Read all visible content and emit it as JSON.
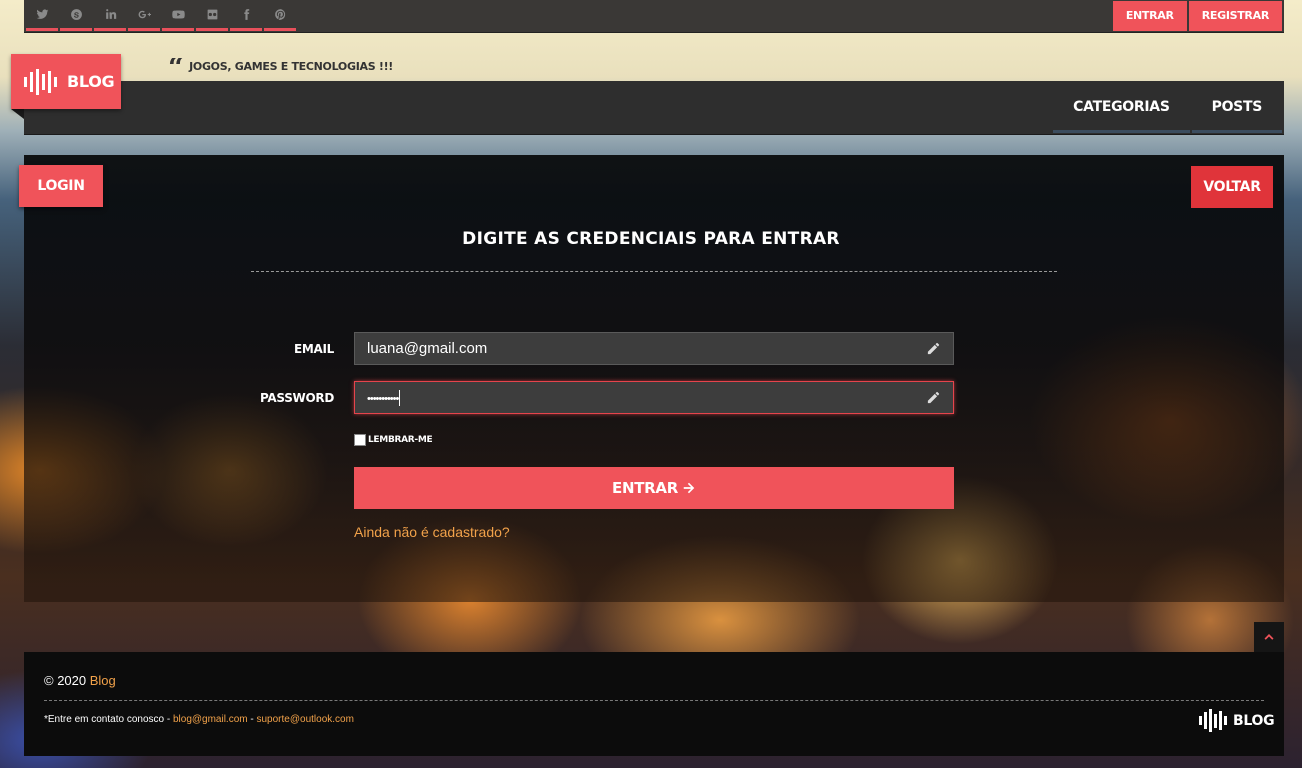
{
  "topbar": {
    "socials": [
      "twitter-icon",
      "skype-icon",
      "linkedin-icon",
      "google-plus-icon",
      "youtube-icon",
      "flickr-icon",
      "facebook-icon",
      "pinterest-icon"
    ],
    "entrar_label": "ENTRAR",
    "registrar_label": "REGISTRAR"
  },
  "brand": {
    "logo_text": "BLOG",
    "tagline": "JOGOS, GAMES E TECNOLOGIAS !!!"
  },
  "nav": {
    "categorias": "CATEGORIAS",
    "posts": "POSTS"
  },
  "login": {
    "tag": "LOGIN",
    "voltar": "VOLTAR",
    "title": "DIGITE AS CREDENCIAIS PARA ENTRAR",
    "email_label": "EMAIL",
    "email_value": "luana@gmail.com",
    "password_label": "PASSWORD",
    "password_value": "•••••••••••",
    "remember_label": "LEMBRAR-ME",
    "submit_label": "ENTRAR",
    "signup_link": "Ainda não é cadastrado?"
  },
  "footer": {
    "copy_prefix": "© 2020",
    "copy_brand": "Blog",
    "contact_prefix": "*Entre em contato conosco -",
    "email1": "blog@gmail.com",
    "sep": "-",
    "email2": "suporte@outlook.com",
    "logo_text": "BLOG"
  },
  "colors": {
    "accent": "#f0535a",
    "link": "#f2a24a"
  }
}
